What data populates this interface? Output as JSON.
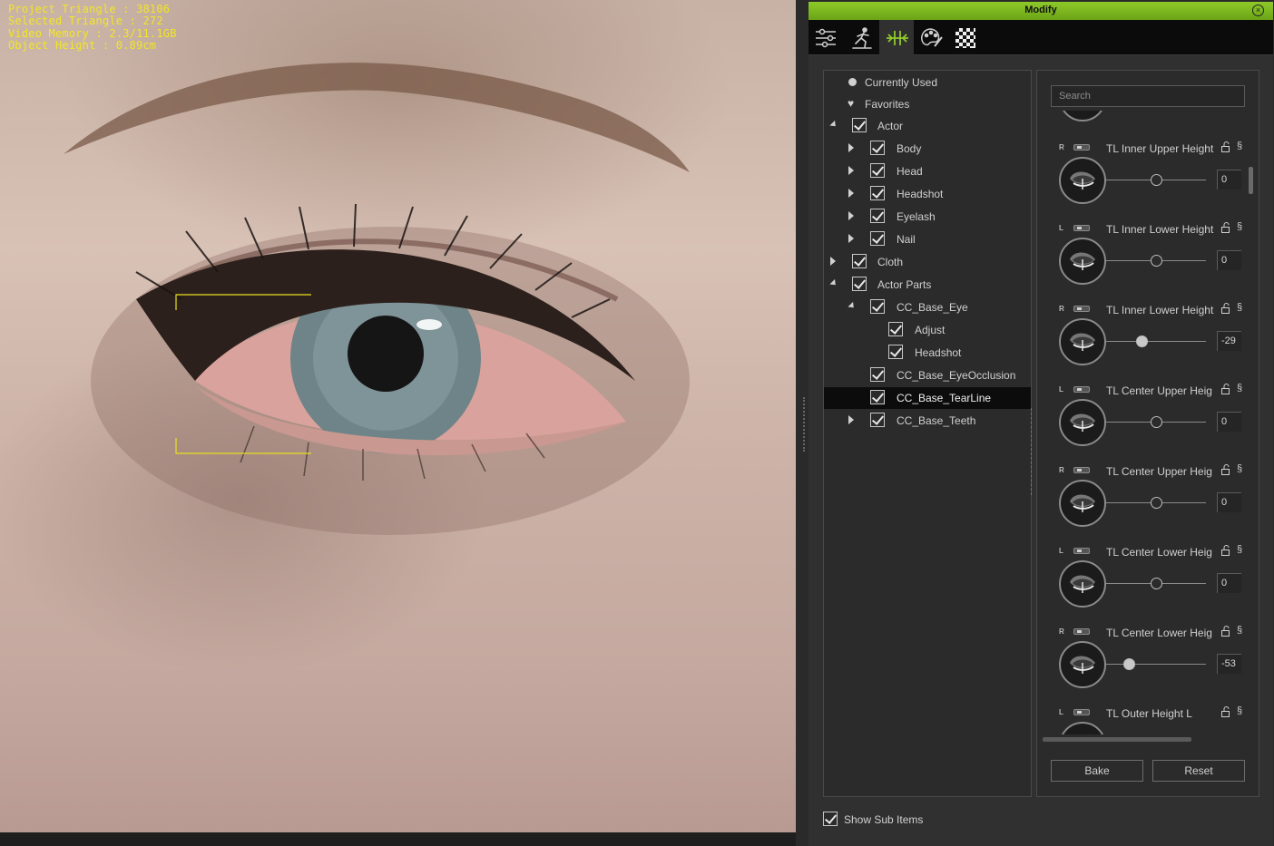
{
  "viewport": {
    "stats": {
      "project_triangle": "Project Triangle : 38106",
      "selected_triangle": "Selected Triangle : 272",
      "video_memory": "Video Memory : 2.3/11.1GB",
      "object_height": "Object Height : 0.89cm"
    }
  },
  "panel": {
    "title": "Modify",
    "close_icon": "×",
    "tabs": [
      {
        "icon": "sliders-icon",
        "active": false
      },
      {
        "icon": "motion-pose-icon",
        "active": false
      },
      {
        "icon": "morph-icon",
        "active": true
      },
      {
        "icon": "material-palette-icon",
        "active": false
      },
      {
        "icon": "texture-checker-icon",
        "active": false
      }
    ],
    "tree": [
      {
        "label": "Currently Used"
      },
      {
        "label": "Favorites"
      },
      {
        "label": "Actor"
      },
      {
        "label": "Body"
      },
      {
        "label": "Head"
      },
      {
        "label": "Headshot"
      },
      {
        "label": "Eyelash"
      },
      {
        "label": "Nail"
      },
      {
        "label": "Cloth"
      },
      {
        "label": "Actor Parts"
      },
      {
        "label": "CC_Base_Eye"
      },
      {
        "label": "Adjust"
      },
      {
        "label": "Headshot"
      },
      {
        "label": "CC_Base_EyeOcclusion"
      },
      {
        "label": "CC_Base_TearLine",
        "selected": true
      },
      {
        "label": "CC_Base_Teeth"
      }
    ],
    "show_sub_items": {
      "label": "Show Sub Items",
      "checked": true
    },
    "search": {
      "placeholder": "Search"
    },
    "sliders": [
      {
        "side": "R",
        "name": "TL Inner Upper Height",
        "value": "0",
        "level": 0.5
      },
      {
        "side": "L",
        "name": "TL Inner Lower Height",
        "value": "0",
        "level": 0.5
      },
      {
        "side": "R",
        "name": "TL Inner Lower Height",
        "value": "-29",
        "level": 0.355
      },
      {
        "side": "L",
        "name": "TL Center Upper Heig",
        "value": "0",
        "level": 0.5
      },
      {
        "side": "R",
        "name": "TL Center Upper Heig",
        "value": "0",
        "level": 0.5
      },
      {
        "side": "L",
        "name": "TL Center Lower Heig",
        "value": "0",
        "level": 0.5
      },
      {
        "side": "R",
        "name": "TL Center Lower Heig",
        "value": "-53",
        "level": 0.235
      },
      {
        "side": "L",
        "name": "TL Outer Height L",
        "value": "",
        "level": 0.5
      }
    ],
    "buttons": {
      "bake": "Bake",
      "reset": "Reset"
    }
  }
}
